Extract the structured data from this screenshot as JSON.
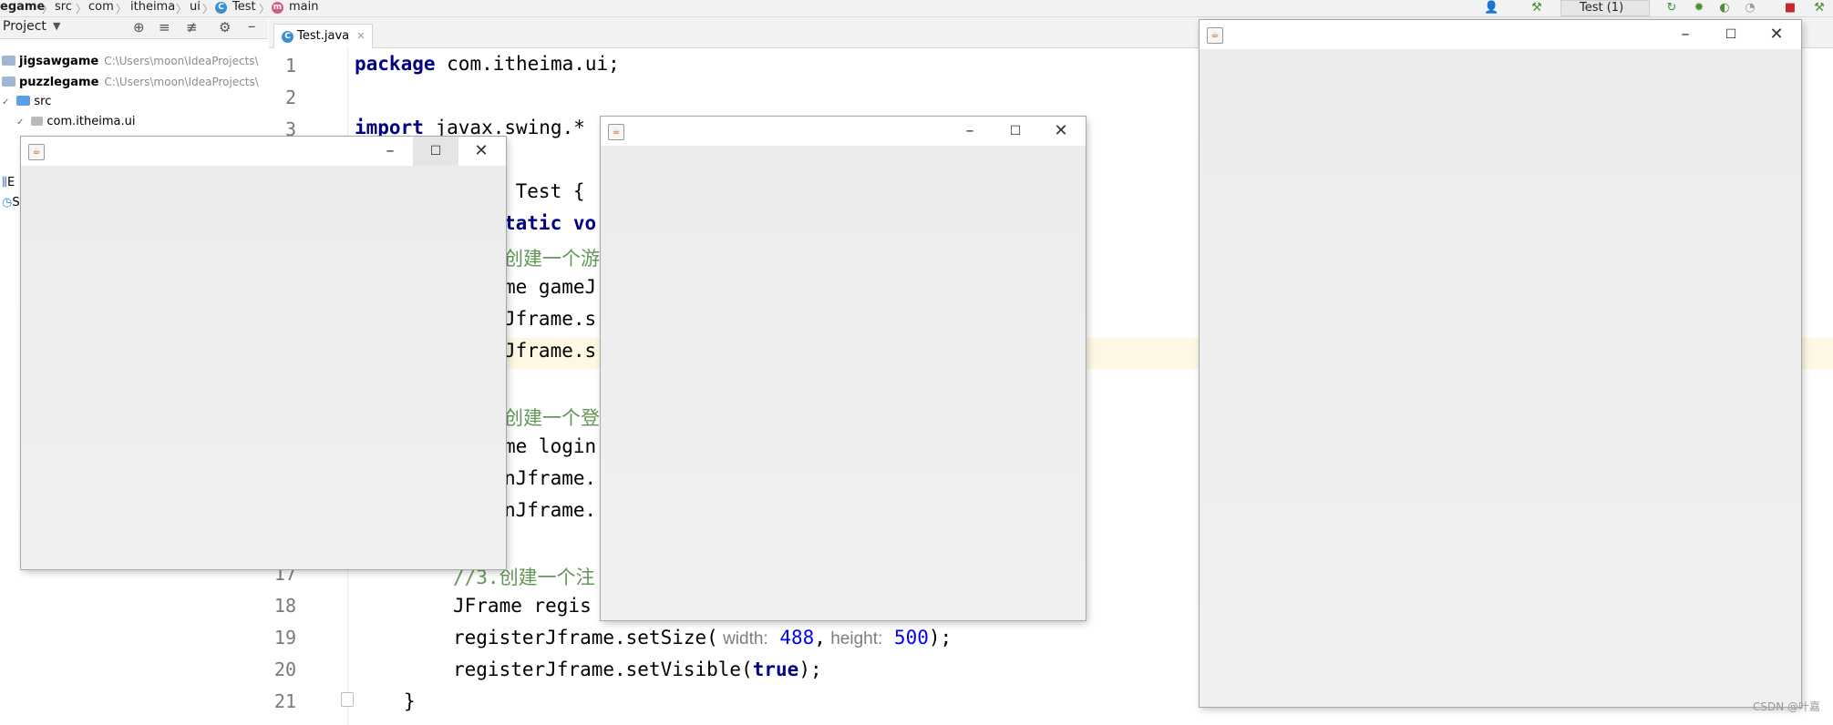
{
  "breadcrumbs": [
    "egame",
    "src",
    "com",
    "itheima",
    "ui",
    "Test",
    "main"
  ],
  "toolbar": {
    "run_config": "Test (1)"
  },
  "project_panel": {
    "header": "Project",
    "tree": [
      {
        "label": "jigsawgame",
        "path": "C:\\Users\\moon\\IdeaProjects\\"
      },
      {
        "label": "puzzlegame",
        "path": "C:\\Users\\moon\\IdeaProjects\\"
      },
      {
        "label": "src"
      },
      {
        "label": "com.itheima.ui"
      }
    ],
    "extra_rows": [
      "E",
      "S"
    ]
  },
  "editor": {
    "tab_label": "Test.java",
    "line_numbers": [
      "1",
      "2",
      "3",
      "17",
      "18",
      "19",
      "20",
      "21"
    ],
    "lines": {
      "l1_kw": "package",
      "l1_rest": " com.itheima.ui;",
      "l3_kw": "import",
      "l3_rest": " javax.swing.*",
      "l5": " Test {",
      "l6_kw": "tatic vo",
      "l7": "创建一个游",
      "l8": "me gameJ",
      "l9": "Jframe.s",
      "l10": "Jframe.s",
      "l12": "创建一个登",
      "l13": "me login",
      "l14": "nJframe.",
      "l15": "nJframe.",
      "l17": "//3.创建一个注",
      "l18": "JFrame regis",
      "l19_call": "registerJframe.setSize(",
      "l19_hint_w": " width:",
      "l19_w": " 488",
      "l19_sep": ",",
      "l19_hint_h": " height:",
      "l19_h": " 500",
      "l19_end": ");",
      "l20_call": "registerJframe.setVisible(",
      "l20_kw": "true",
      "l20_end": ");",
      "l21": "}"
    }
  },
  "windows": {
    "min_glyph": "–",
    "max_glyph": "☐",
    "close_glyph": "✕",
    "icon_glyph": "☕"
  },
  "watermark": "CSDN @叶嘉"
}
